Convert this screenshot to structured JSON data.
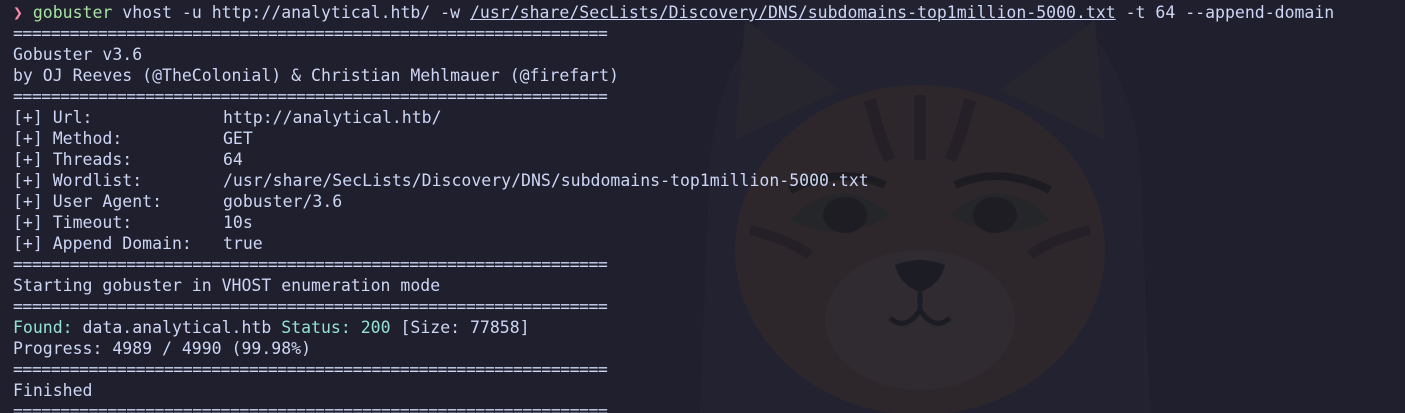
{
  "prompt": {
    "symbol": "❯",
    "command": "gobuster",
    "args_before": " vhost -u http://analytical.htb/ -w ",
    "wordlist_arg": "/usr/share/SecLists/Discovery/DNS/subdomains-top1million-5000.txt",
    "args_after": " -t 64 --append-domain"
  },
  "separator": "===============================================================",
  "banner": {
    "version": "Gobuster v3.6",
    "authors": "by OJ Reeves (@TheColonial) & Christian Mehlmauer (@firefart)"
  },
  "options": [
    {
      "key": "[+] Url:",
      "value": "http://analytical.htb/"
    },
    {
      "key": "[+] Method:",
      "value": "GET"
    },
    {
      "key": "[+] Threads:",
      "value": "64"
    },
    {
      "key": "[+] Wordlist:",
      "value": "/usr/share/SecLists/Discovery/DNS/subdomains-top1million-5000.txt"
    },
    {
      "key": "[+] User Agent:",
      "value": "gobuster/3.6"
    },
    {
      "key": "[+] Timeout:",
      "value": "10s"
    },
    {
      "key": "[+] Append Domain:",
      "value": "true"
    }
  ],
  "starting": "Starting gobuster in VHOST enumeration mode",
  "result": {
    "found_label": "Found:",
    "host": " data.analytical.htb ",
    "status_label": "Status:",
    "status_code": " 200",
    "size": " [Size: 77858]"
  },
  "progress": "Progress: 4989 / 4990 (99.98%)",
  "finished": "Finished",
  "colors": {
    "background": "#1f1f2d",
    "text": "#cdd6f4",
    "prompt": "#f38ba8",
    "command": "#a6e3a1",
    "found": "#94e2d5"
  }
}
